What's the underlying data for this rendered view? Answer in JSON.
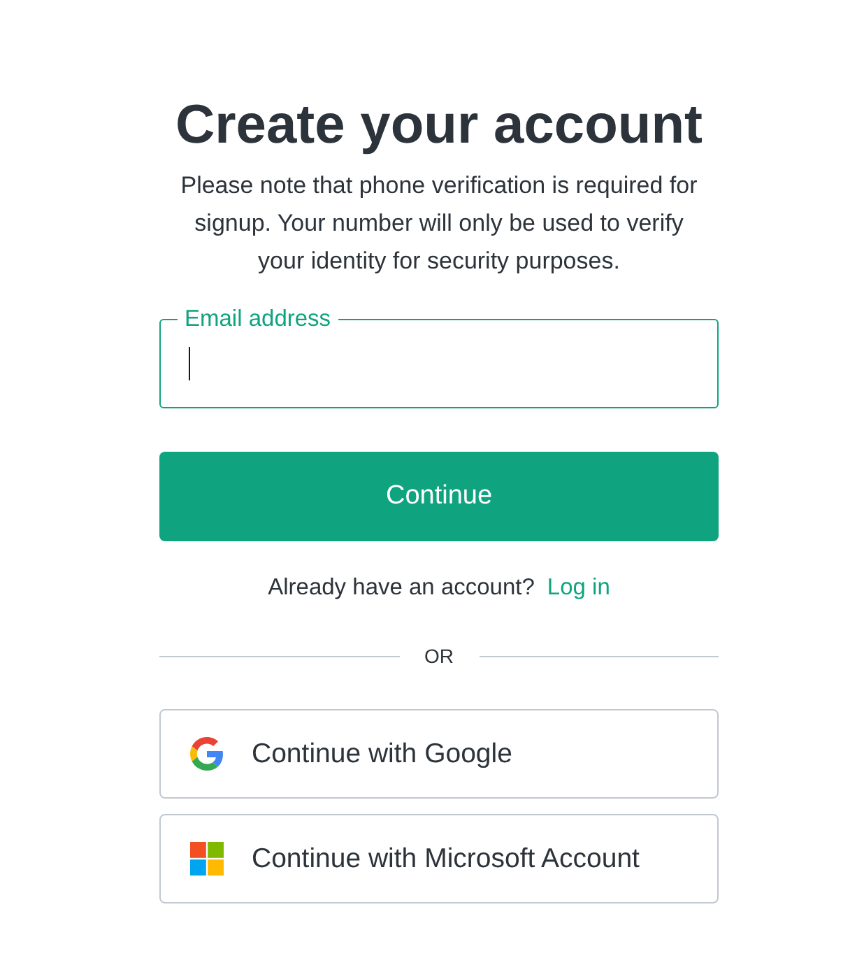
{
  "heading": "Create your account",
  "description": "Please note that phone verification is required for signup. Your number will only be used to verify your identity for security purposes.",
  "email_field": {
    "label": "Email address",
    "focused": true
  },
  "continue_button": "Continue",
  "login_prompt": {
    "text": "Already have an account?",
    "link": "Log in"
  },
  "divider": "OR",
  "social_buttons": [
    {
      "kind": "google",
      "label": "Continue with Google"
    },
    {
      "kind": "microsoft",
      "label": "Continue with Microsoft Account"
    }
  ]
}
